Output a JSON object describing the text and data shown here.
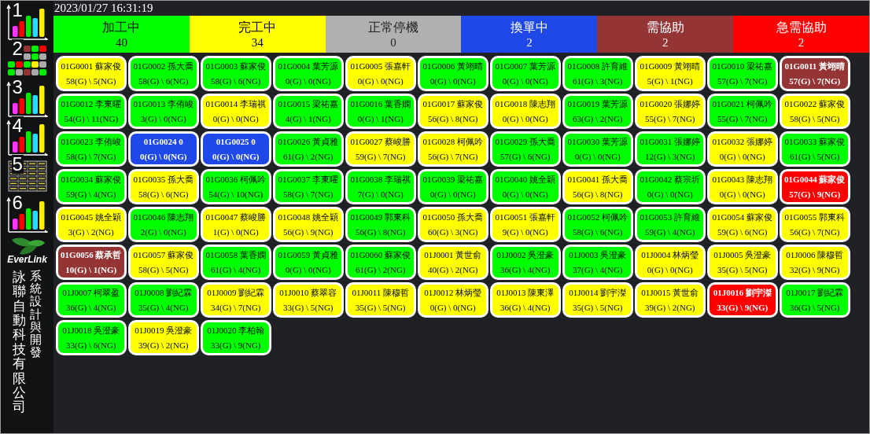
{
  "sidebar": {
    "nav": [
      {
        "label": "1",
        "kind": "chart"
      },
      {
        "label": "2",
        "kind": "tiles"
      },
      {
        "label": "3",
        "kind": "chart"
      },
      {
        "label": "4",
        "kind": "chart"
      },
      {
        "label": "5",
        "kind": "table"
      },
      {
        "label": "6",
        "kind": "chart"
      }
    ],
    "logo_text": "EverLink",
    "company": "詠聯自動科技有限公司",
    "credit": "系統設計與開發"
  },
  "datetime": "2023/01/27 16:31:19",
  "legend": [
    {
      "label": "加工中",
      "count": "40",
      "kind": "running",
      "color": "#00ff00"
    },
    {
      "label": "完工中",
      "count": "34",
      "kind": "finishing",
      "color": "#ffff00"
    },
    {
      "label": "正常停機",
      "count": "0",
      "kind": "stopped",
      "color": "#b0b0b0"
    },
    {
      "label": "換單中",
      "count": "2",
      "kind": "changeover",
      "color": "#1f48e8"
    },
    {
      "label": "需協助",
      "count": "2",
      "kind": "help",
      "color": "#943434"
    },
    {
      "label": "急需協助",
      "count": "2",
      "kind": "urgent",
      "color": "#ff0000"
    }
  ],
  "machines": [
    {
      "code": "01G0001",
      "operator": "蘇家俊",
      "output": "58(G) \\ 5(NG)",
      "kind": "finishing"
    },
    {
      "code": "01G0002",
      "operator": "孫大喬",
      "output": "58(G) \\ 6(NG)",
      "kind": "running"
    },
    {
      "code": "01G0003",
      "operator": "蘇家俊",
      "output": "58(G) \\ 6(NG)",
      "kind": "running"
    },
    {
      "code": "01G0004",
      "operator": "葉芳源",
      "output": "0(G) \\ 0(NG)",
      "kind": "running"
    },
    {
      "code": "01G0005",
      "operator": "張嘉軒",
      "output": "0(G) \\ 0(NG)",
      "kind": "finishing"
    },
    {
      "code": "01G0006",
      "operator": "黃翊晴",
      "output": "0(G) \\ 0(NG)",
      "kind": "running"
    },
    {
      "code": "01G0007",
      "operator": "葉芳源",
      "output": "0(G) \\ 0(NG)",
      "kind": "running"
    },
    {
      "code": "01G0008",
      "operator": "許育維",
      "output": "61(G) \\ 3(NG)",
      "kind": "running"
    },
    {
      "code": "01G0009",
      "operator": "黃翊晴",
      "output": "5(G) \\ 1(NG)",
      "kind": "finishing"
    },
    {
      "code": "01G0010",
      "operator": "梁祐嘉",
      "output": "57(G) \\ 7(NG)",
      "kind": "running"
    },
    {
      "code": "01G0011",
      "operator": "黃翊晴",
      "output": "57(G) \\ 7(NG)",
      "kind": "help"
    },
    {
      "code": "01G0012",
      "operator": "李東曜",
      "output": "54(G) \\ 11(NG)",
      "kind": "running"
    },
    {
      "code": "01G0013",
      "operator": "李侑峻",
      "output": "3(G) \\ 0(NG)",
      "kind": "running"
    },
    {
      "code": "01G0014",
      "operator": "李瑞祺",
      "output": "0(G) \\ 0(NG)",
      "kind": "finishing"
    },
    {
      "code": "01G0015",
      "operator": "梁祐嘉",
      "output": "4(G) \\ 1(NG)",
      "kind": "running"
    },
    {
      "code": "01G0016",
      "operator": "葉香嫻",
      "output": "0(G) \\ 1(NG)",
      "kind": "running"
    },
    {
      "code": "01G0017",
      "operator": "蘇家俊",
      "output": "56(G) \\ 8(NG)",
      "kind": "finishing"
    },
    {
      "code": "01G0018",
      "operator": "陳志翔",
      "output": "0(G) \\ 0(NG)",
      "kind": "finishing"
    },
    {
      "code": "01G0019",
      "operator": "葉芳源",
      "output": "63(G) \\ 2(NG)",
      "kind": "running"
    },
    {
      "code": "01G0020",
      "operator": "張娜婷",
      "output": "55(G) \\ 7(NG)",
      "kind": "finishing"
    },
    {
      "code": "01G0021",
      "operator": "柯佩吟",
      "output": "55(G) \\ 7(NG)",
      "kind": "running"
    },
    {
      "code": "01G0022",
      "operator": "蘇家俊",
      "output": "58(G) \\ 5(NG)",
      "kind": "finishing"
    },
    {
      "code": "01G0023",
      "operator": "李侑峻",
      "output": "58(G) \\ 7(NG)",
      "kind": "running"
    },
    {
      "code": "01G0024",
      "operator": "0",
      "output": "0(G) \\ 0(NG)",
      "kind": "changeover"
    },
    {
      "code": "01G0025",
      "operator": "0",
      "output": "0(G) \\ 0(NG)",
      "kind": "changeover"
    },
    {
      "code": "01G0026",
      "operator": "黃貞雅",
      "output": "61(G) \\ 2(NG)",
      "kind": "running"
    },
    {
      "code": "01G0027",
      "operator": "蔡峻勝",
      "output": "59(G) \\ 7(NG)",
      "kind": "finishing"
    },
    {
      "code": "01G0028",
      "operator": "柯佩吟",
      "output": "56(G) \\ 7(NG)",
      "kind": "finishing"
    },
    {
      "code": "01G0029",
      "operator": "孫大喬",
      "output": "57(G) \\ 6(NG)",
      "kind": "running"
    },
    {
      "code": "01G0030",
      "operator": "葉芳源",
      "output": "0(G) \\ 0(NG)",
      "kind": "running"
    },
    {
      "code": "01G0031",
      "operator": "張娜婷",
      "output": "12(G) \\ 3(NG)",
      "kind": "running"
    },
    {
      "code": "01G0032",
      "operator": "張娜婷",
      "output": "0(G) \\ 0(NG)",
      "kind": "finishing"
    },
    {
      "code": "01G0033",
      "operator": "蘇家俊",
      "output": "61(G) \\ 5(NG)",
      "kind": "running"
    },
    {
      "code": "01G0034",
      "operator": "蘇家俊",
      "output": "59(G) \\ 4(NG)",
      "kind": "running"
    },
    {
      "code": "01G0035",
      "operator": "孫大喬",
      "output": "58(G) \\ 6(NG)",
      "kind": "finishing"
    },
    {
      "code": "01G0036",
      "operator": "柯佩吟",
      "output": "54(G) \\ 10(NG)",
      "kind": "running"
    },
    {
      "code": "01G0037",
      "operator": "李東曜",
      "output": "58(G) \\ 7(NG)",
      "kind": "running"
    },
    {
      "code": "01G0038",
      "operator": "李瑞祺",
      "output": "7(G) \\ 0(NG)",
      "kind": "running"
    },
    {
      "code": "01G0039",
      "operator": "梁祐嘉",
      "output": "0(G) \\ 0(NG)",
      "kind": "running"
    },
    {
      "code": "01G0040",
      "operator": "姚全穎",
      "output": "0(G) \\ 0(NG)",
      "kind": "running"
    },
    {
      "code": "01G0041",
      "operator": "孫大喬",
      "output": "56(G) \\ 8(NG)",
      "kind": "finishing"
    },
    {
      "code": "01G0042",
      "operator": "蔡宗圻",
      "output": "0(G) \\ 0(NG)",
      "kind": "running"
    },
    {
      "code": "01G0043",
      "operator": "陳志翔",
      "output": "0(G) \\ 0(NG)",
      "kind": "finishing"
    },
    {
      "code": "01G0044",
      "operator": "蘇家俊",
      "output": "57(G) \\ 9(NG)",
      "kind": "urgent"
    },
    {
      "code": "01G0045",
      "operator": "姚全穎",
      "output": "3(G) \\ 2(NG)",
      "kind": "finishing"
    },
    {
      "code": "01G0046",
      "operator": "陳志翔",
      "output": "2(G) \\ 0(NG)",
      "kind": "running"
    },
    {
      "code": "01G0047",
      "operator": "蔡峻勝",
      "output": "1(G) \\ 0(NG)",
      "kind": "finishing"
    },
    {
      "code": "01G0048",
      "operator": "姚全穎",
      "output": "56(G) \\ 9(NG)",
      "kind": "finishing"
    },
    {
      "code": "01G0049",
      "operator": "郭東科",
      "output": "56(G) \\ 8(NG)",
      "kind": "running"
    },
    {
      "code": "01G0050",
      "operator": "孫大喬",
      "output": "60(G) \\ 3(NG)",
      "kind": "finishing"
    },
    {
      "code": "01G0051",
      "operator": "張嘉軒",
      "output": "9(G) \\ 0(NG)",
      "kind": "finishing"
    },
    {
      "code": "01G0052",
      "operator": "柯佩吟",
      "output": "58(G) \\ 6(NG)",
      "kind": "running"
    },
    {
      "code": "01G0053",
      "operator": "許育維",
      "output": "59(G) \\ 4(NG)",
      "kind": "running"
    },
    {
      "code": "01G0054",
      "operator": "蘇家俊",
      "output": "59(G) \\ 6(NG)",
      "kind": "finishing"
    },
    {
      "code": "01G0055",
      "operator": "郭東科",
      "output": "56(G) \\ 7(NG)",
      "kind": "finishing"
    },
    {
      "code": "01G0056",
      "operator": "蔡承哲",
      "output": "10(G) \\ 1(NG)",
      "kind": "help"
    },
    {
      "code": "01G0057",
      "operator": "蘇家俊",
      "output": "58(G) \\ 5(NG)",
      "kind": "finishing"
    },
    {
      "code": "01G0058",
      "operator": "葉香嫻",
      "output": "61(G) \\ 4(NG)",
      "kind": "running"
    },
    {
      "code": "01G0059",
      "operator": "黃貞雅",
      "output": "0(G) \\ 0(NG)",
      "kind": "running"
    },
    {
      "code": "01G0060",
      "operator": "蘇家俊",
      "output": "61(G) \\ 2(NG)",
      "kind": "running"
    },
    {
      "code": "01J0001",
      "operator": "黃世俞",
      "output": "40(G) \\ 2(NG)",
      "kind": "finishing"
    },
    {
      "code": "01J0002",
      "operator": "吳澄豪",
      "output": "36(G) \\ 4(NG)",
      "kind": "running"
    },
    {
      "code": "01J0003",
      "operator": "吳澄豪",
      "output": "37(G) \\ 4(NG)",
      "kind": "running"
    },
    {
      "code": "01J0004",
      "operator": "林炳瑩",
      "output": "0(G) \\ 0(NG)",
      "kind": "finishing"
    },
    {
      "code": "01J0005",
      "operator": "吳澄豪",
      "output": "35(G) \\ 5(NG)",
      "kind": "finishing"
    },
    {
      "code": "01J0006",
      "operator": "陳穆哲",
      "output": "32(G) \\ 9(NG)",
      "kind": "finishing"
    },
    {
      "code": "01J0007",
      "operator": "柯翠盈",
      "output": "36(G) \\ 4(NG)",
      "kind": "running"
    },
    {
      "code": "01J0008",
      "operator": "劉紀霖",
      "output": "35(G) \\ 4(NG)",
      "kind": "running"
    },
    {
      "code": "01J0009",
      "operator": "劉紀霖",
      "output": "34(G) \\ 7(NG)",
      "kind": "finishing"
    },
    {
      "code": "01J0010",
      "operator": "蔡翠容",
      "output": "33(G) \\ 5(NG)",
      "kind": "finishing"
    },
    {
      "code": "01J0011",
      "operator": "陳穆哲",
      "output": "35(G) \\ 5(NG)",
      "kind": "finishing"
    },
    {
      "code": "01J0012",
      "operator": "林炳瑩",
      "output": "0(G) \\ 0(NG)",
      "kind": "finishing"
    },
    {
      "code": "01J0013",
      "operator": "陳東澤",
      "output": "36(G) \\ 4(NG)",
      "kind": "finishing"
    },
    {
      "code": "01J0014",
      "operator": "劉宇滐",
      "output": "35(G) \\ 5(NG)",
      "kind": "finishing"
    },
    {
      "code": "01J0015",
      "operator": "黃世俞",
      "output": "39(G) \\ 2(NG)",
      "kind": "finishing"
    },
    {
      "code": "01J0016",
      "operator": "劉宇滐",
      "output": "33(G) \\ 9(NG)",
      "kind": "urgent"
    },
    {
      "code": "01J0017",
      "operator": "劉紀霖",
      "output": "36(G) \\ 5(NG)",
      "kind": "running"
    },
    {
      "code": "01J0018",
      "operator": "吳澄豪",
      "output": "33(G) \\ 6(NG)",
      "kind": "running"
    },
    {
      "code": "01J0019",
      "operator": "吳澄豪",
      "output": "39(G) \\ 2(NG)",
      "kind": "finishing"
    },
    {
      "code": "01J0020",
      "operator": "李柏翰",
      "output": "33(G) \\ 9(NG)",
      "kind": "running"
    }
  ]
}
